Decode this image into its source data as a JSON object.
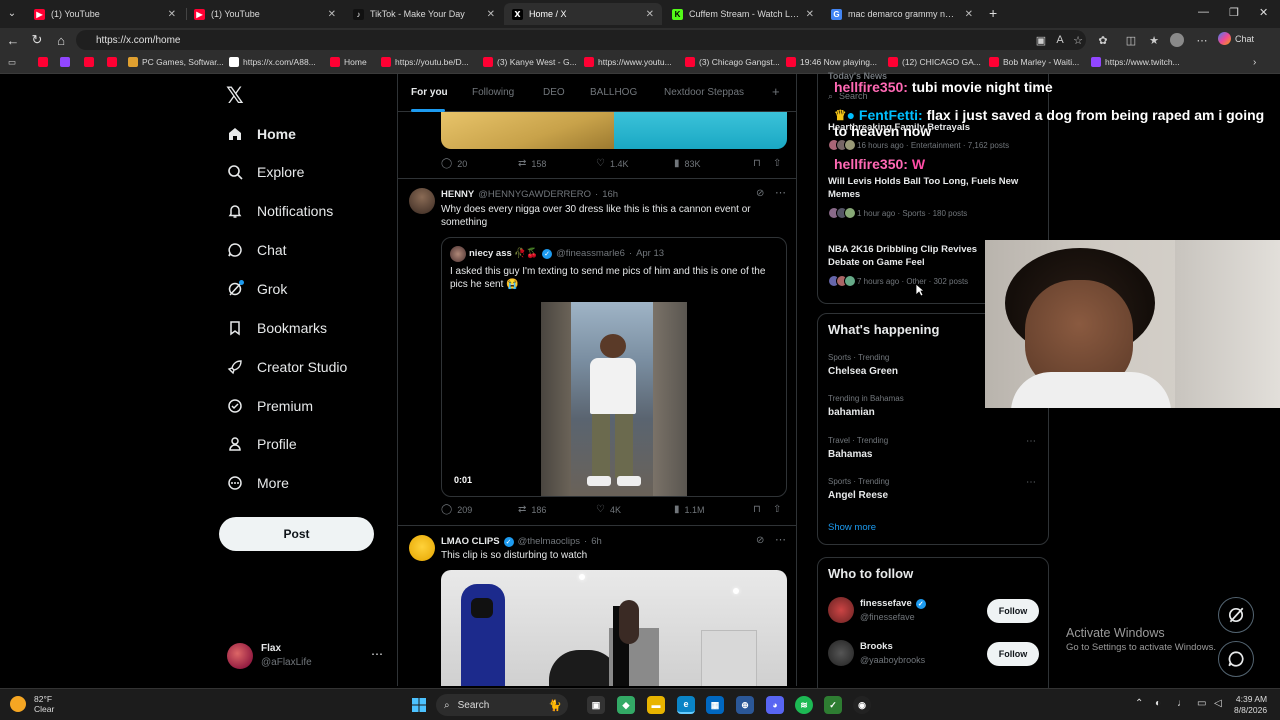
{
  "browser": {
    "tabs": [
      {
        "title": "(1) YouTube",
        "fav_color": "#ff0033",
        "fav_glyph": "▶"
      },
      {
        "title": "(1) YouTube",
        "fav_color": "#ff0033",
        "fav_glyph": "▶"
      },
      {
        "title": "TikTok - Make Your Day",
        "fav_color": "#111111",
        "fav_glyph": "♪"
      },
      {
        "title": "Home / X",
        "fav_color": "#000000",
        "fav_glyph": "X"
      },
      {
        "title": "Cuffem Stream - Watch Live on Ki",
        "fav_color": "#53fc18",
        "fav_glyph": "K"
      },
      {
        "title": "mac demarco grammy nomination",
        "fav_color": "#4285f4",
        "fav_glyph": "G"
      }
    ],
    "url": "https://x.com/home",
    "chat_label": "Chat",
    "bookmarks": [
      {
        "label": "",
        "color": "#ff0033"
      },
      {
        "label": "",
        "color": "#9146ff"
      },
      {
        "label": "",
        "color": "#ff0033"
      },
      {
        "label": "",
        "color": "#ff0033"
      },
      {
        "label": "PC Games, Softwar...",
        "color": "#e0a030"
      },
      {
        "label": "https://x.com/A88...",
        "color": "#ffffff"
      },
      {
        "label": "Home",
        "color": "#ff0033"
      },
      {
        "label": "https://youtu.be/D...",
        "color": "#ff0033"
      },
      {
        "label": "(3) Kanye West - G...",
        "color": "#ff0033"
      },
      {
        "label": "https://www.youtu...",
        "color": "#ff0033"
      },
      {
        "label": "(3) Chicago Gangst...",
        "color": "#ff0033"
      },
      {
        "label": "19:46 Now playing...",
        "color": "#ff0033"
      },
      {
        "label": "(12) CHICAGO GA...",
        "color": "#ff0033"
      },
      {
        "label": "Bob Marley - Waiti...",
        "color": "#ff0033"
      },
      {
        "label": "https://www.twitch...",
        "color": "#9146ff"
      }
    ]
  },
  "sidebar": {
    "logo": "𝕏",
    "items": [
      {
        "label": "Home",
        "icon": "home-icon"
      },
      {
        "label": "Explore",
        "icon": "search-icon"
      },
      {
        "label": "Notifications",
        "icon": "bell-icon"
      },
      {
        "label": "Chat",
        "icon": "chat-icon"
      },
      {
        "label": "Grok",
        "icon": "grok-icon"
      },
      {
        "label": "Bookmarks",
        "icon": "bookmark-icon"
      },
      {
        "label": "Creator Studio",
        "icon": "rocket-icon"
      },
      {
        "label": "Premium",
        "icon": "premium-icon"
      },
      {
        "label": "Profile",
        "icon": "profile-icon"
      },
      {
        "label": "More",
        "icon": "more-icon"
      }
    ],
    "post_label": "Post",
    "account": {
      "name": "Flax",
      "handle": "@aFlaxLife"
    }
  },
  "feed": {
    "tabs": [
      "For you",
      "Following",
      "DEO",
      "BALLHOG",
      "Nextdoor Steppas",
      "+"
    ],
    "post0_stats": {
      "replies": "20",
      "reposts": "158",
      "likes": "1.4K",
      "views": "83K"
    },
    "post1": {
      "name": "HENNY",
      "handle": "@HENNYGAWDERRERO",
      "time": "16h",
      "text": "Why does every nigga over 30 dress like this is this a cannon event or something",
      "quote": {
        "name": "niecy ass 🥀🍒",
        "handle": "@fineassmarle6",
        "time": "Apr 13",
        "text": "I asked this guy I'm texting to send me pics of him and this is one of the pics he sent 😭",
        "video_time": "0:01"
      },
      "stats": {
        "replies": "209",
        "reposts": "186",
        "likes": "4K",
        "views": "1.1M"
      }
    },
    "post2": {
      "name": "LMAO CLIPS",
      "handle": "@thelmaoclips",
      "time": "6h",
      "text": "This clip is so disturbing to watch"
    }
  },
  "right": {
    "search_placeholder": "Search",
    "news_header": "Today's News",
    "stories": [
      {
        "title": "Heartbreaking Family Betrayals",
        "meta": "16 hours ago · Entertainment · 7,162 posts"
      },
      {
        "title": "Will Levis Holds Ball Too Long, Fuels New Memes",
        "meta": "1 hour ago · Sports · 180 posts"
      },
      {
        "title": "NBA 2K16 Dribbling Clip Revives Debate on Game Feel",
        "meta": "7 hours ago · Other · 302 posts"
      }
    ],
    "happening_title": "What's happening",
    "trends": [
      {
        "context": "Sports · Trending",
        "name": "Chelsea Green"
      },
      {
        "context": "Trending in Bahamas",
        "name": "bahamian"
      },
      {
        "context": "Travel · Trending",
        "name": "Bahamas"
      },
      {
        "context": "Sports · Trending",
        "name": "Angel Reese"
      }
    ],
    "show_more": "Show more",
    "who_to_follow_title": "Who to follow",
    "follow": [
      {
        "name": "finessefave",
        "handle": "@finessefave",
        "verified": true,
        "button": "Follow"
      },
      {
        "name": "Brooks",
        "handle": "@yaaboybrooks",
        "verified": false,
        "button": "Follow"
      }
    ]
  },
  "overlay_chat": [
    {
      "user": "hellfire350:",
      "msg": "tubi movie night time",
      "user_color": "#ff69b4",
      "msg_color": "#ffffff"
    },
    {
      "user": "FentFetti:",
      "msg": "flax i just saved a dog from being raped am i going to heaven now",
      "user_color": "#00bfff",
      "msg_color": "#ffffff"
    },
    {
      "user": "hellfire350:",
      "msg": "W",
      "user_color": "#ff69b4",
      "msg_color": "#ff4da6"
    }
  ],
  "activate_windows": {
    "title": "Activate Windows",
    "subtitle": "Go to Settings to activate Windows."
  },
  "taskbar": {
    "weather_temp": "82°F",
    "weather_cond": "Clear",
    "search_label": "Search",
    "time": "4:39 AM",
    "date": "8/8/2026"
  }
}
